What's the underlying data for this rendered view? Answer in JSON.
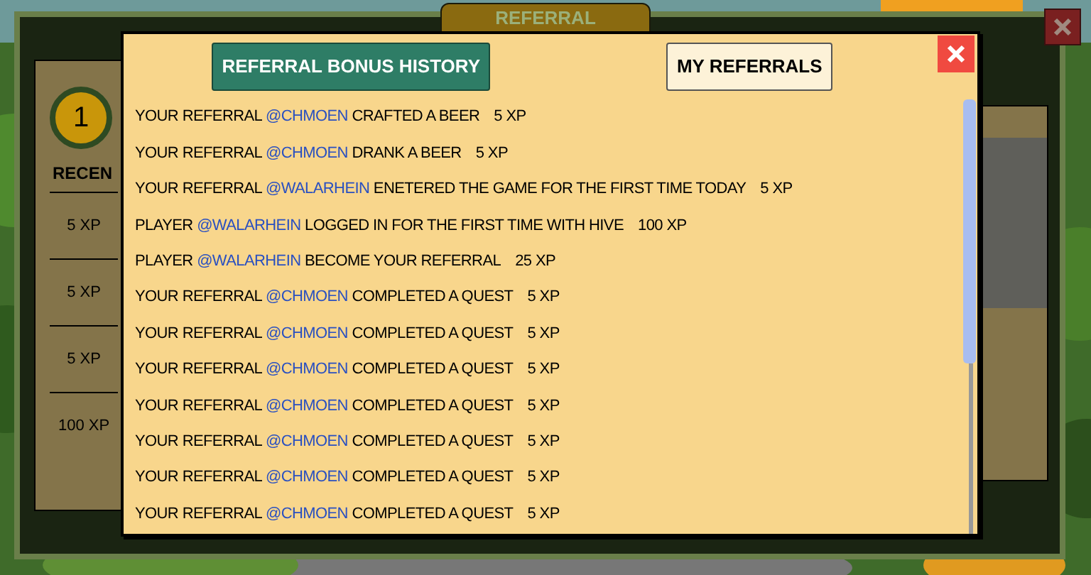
{
  "background_panel": {
    "tab_title": "REFERRAL",
    "level_badge": "1",
    "recent_heading": "RECEN",
    "recent_rewards": [
      "5 XP",
      "5 XP",
      "5 XP",
      "100 XP"
    ]
  },
  "dialog": {
    "tabs": [
      {
        "label": "REFERRAL BONUS HISTORY",
        "selected": true
      },
      {
        "label": "MY REFERRALS",
        "selected": false
      }
    ],
    "entries": [
      {
        "prefix": "YOUR REFERRAL",
        "user": "@CHMOEN",
        "action": "CRAFTED A BEER",
        "xp": "5 XP"
      },
      {
        "prefix": "YOUR REFERRAL",
        "user": "@CHMOEN",
        "action": "DRANK A BEER",
        "xp": "5 XP"
      },
      {
        "prefix": "YOUR REFERRAL",
        "user": "@WALARHEIN",
        "action": "ENETERED THE GAME FOR THE FIRST TIME TODAY",
        "xp": "5 XP"
      },
      {
        "prefix": "PLAYER",
        "user": "@WALARHEIN",
        "action": "LOGGED IN FOR THE FIRST TIME WITH HIVE",
        "xp": "100 XP"
      },
      {
        "prefix": "PLAYER",
        "user": "@WALARHEIN",
        "action": "BECOME YOUR REFERRAL",
        "xp": "25 XP"
      },
      {
        "prefix": "YOUR REFERRAL",
        "user": "@CHMOEN",
        "action": "COMPLETED A QUEST",
        "xp": "5 XP"
      },
      {
        "prefix": "YOUR REFERRAL",
        "user": "@CHMOEN",
        "action": "COMPLETED A QUEST",
        "xp": "5 XP"
      },
      {
        "prefix": "YOUR REFERRAL",
        "user": "@CHMOEN",
        "action": "COMPLETED A QUEST",
        "xp": "5 XP"
      },
      {
        "prefix": "YOUR REFERRAL",
        "user": "@CHMOEN",
        "action": "COMPLETED A QUEST",
        "xp": "5 XP"
      },
      {
        "prefix": "YOUR REFERRAL",
        "user": "@CHMOEN",
        "action": "COMPLETED A QUEST",
        "xp": "5 XP"
      },
      {
        "prefix": "YOUR REFERRAL",
        "user": "@CHMOEN",
        "action": "COMPLETED A QUEST",
        "xp": "5 XP"
      },
      {
        "prefix": "YOUR REFERRAL",
        "user": "@CHMOEN",
        "action": "COMPLETED A QUEST",
        "xp": "5 XP"
      }
    ]
  }
}
